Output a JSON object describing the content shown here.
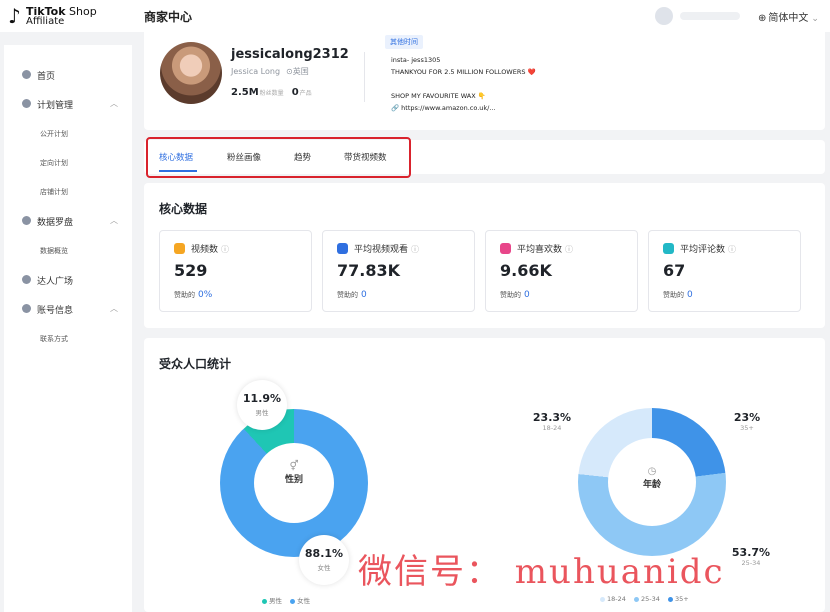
{
  "brand": {
    "logo_line1_bold": "TikTok",
    "logo_line1_rest": " Shop",
    "logo_line2": "Affiliate"
  },
  "header": {
    "title": "商家中心",
    "language": "简体中文"
  },
  "sidebar": {
    "items": [
      {
        "label": "首页",
        "type": "main"
      },
      {
        "label": "计划管理",
        "type": "main",
        "expandable": true
      },
      {
        "label": "公开计划",
        "type": "sub"
      },
      {
        "label": "定向计划",
        "type": "sub"
      },
      {
        "label": "店铺计划",
        "type": "sub"
      },
      {
        "label": "数据罗盘",
        "type": "main",
        "expandable": true
      },
      {
        "label": "数据概览",
        "type": "sub"
      },
      {
        "label": "达人广场",
        "type": "main"
      },
      {
        "label": "账号信息",
        "type": "main",
        "expandable": true
      },
      {
        "label": "联系方式",
        "type": "sub"
      }
    ]
  },
  "profile": {
    "handle": "jessicalong2312",
    "name": "Jessica Long",
    "location": "英国",
    "followers": "2.5M",
    "followers_label": "粉丝数量",
    "products": "0",
    "products_label": "产品",
    "bio_tag": "其他时间",
    "bio_lines": [
      "insta- jess1305",
      "THANKYOU FOR 2.5 MILLION FOLLOWERS ❤️",
      "",
      "SHOP MY FAVOURITE WAX 👇"
    ],
    "bio_link": "https://www.amazon.co.uk/..."
  },
  "tabs": [
    "核心数据",
    "粉丝画像",
    "趋势",
    "带货视频数"
  ],
  "core": {
    "title": "核心数据",
    "metrics": [
      {
        "label": "视频数",
        "value": "529",
        "foot_label": "赞助的",
        "foot_value": "0%",
        "color": "#f5a623"
      },
      {
        "label": "平均视频观看",
        "value": "77.83K",
        "foot_label": "赞助的",
        "foot_value": "0",
        "color": "#2f6fe0"
      },
      {
        "label": "平均喜欢数",
        "value": "9.66K",
        "foot_label": "赞助的",
        "foot_value": "0",
        "color": "#e8468a"
      },
      {
        "label": "平均评论数",
        "value": "67",
        "foot_label": "赞助的",
        "foot_value": "0",
        "color": "#22b8c6"
      }
    ]
  },
  "audience": {
    "title": "受众人口统计",
    "gender": {
      "center": "性别",
      "male_value": "11.9%",
      "male_label": "男性",
      "female_value": "88.1%",
      "female_label": "女性",
      "legend": [
        "男性",
        "女性"
      ],
      "colors": {
        "male": "#1fc6b4",
        "female": "#4aa3f0"
      }
    },
    "age": {
      "center": "年龄",
      "segments": [
        {
          "label": "18-24",
          "value": "23.3%"
        },
        {
          "label": "35+",
          "value": "23%"
        },
        {
          "label": "25-34",
          "value": "53.7%"
        }
      ],
      "legend": [
        "18-24",
        "25-34",
        "35+"
      ],
      "colors": {
        "18-24": "#d6e9fb",
        "25-34": "#8ec8f5",
        "35+": "#3f93e8"
      }
    }
  },
  "watermark": "微信号： muhuanidc"
}
